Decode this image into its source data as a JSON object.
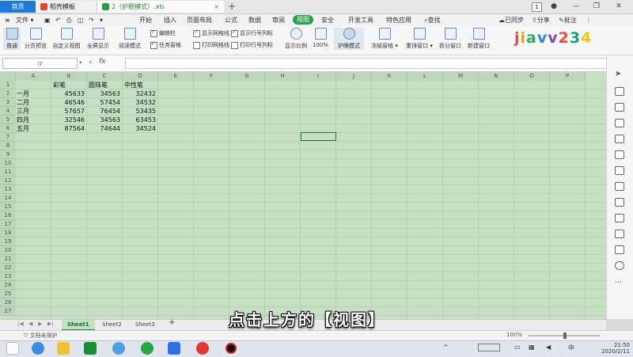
{
  "titlebar": {
    "tabs": [
      {
        "label": "首页"
      },
      {
        "label": "稻壳模板"
      },
      {
        "label": "2（护眼模式）.xls"
      }
    ],
    "add_tab": "+",
    "page_indicator": "1"
  },
  "menu": {
    "file_label": "文件",
    "items": [
      "开始",
      "插入",
      "页面布局",
      "公式",
      "数据",
      "审阅",
      "视图",
      "安全",
      "开发工具",
      "特色应用"
    ],
    "active": "视图",
    "search": "查找",
    "sync": "已同步",
    "share": "分享",
    "comment": "批注"
  },
  "ribbon": {
    "buttons": [
      "普通",
      "分页预览",
      "自定义视图",
      "全屏显示",
      "阅读模式",
      "显示比例",
      "100%",
      "护眼模式",
      "冻结窗格",
      "重排窗口",
      "拆分窗口",
      "新建窗口"
    ],
    "checks": [
      {
        "label": "编辑栏",
        "checked": true
      },
      {
        "label": "显示网格线",
        "checked": true
      },
      {
        "label": "显示行号列标",
        "checked": true
      },
      {
        "label": "任务窗格",
        "checked": true
      },
      {
        "label": "打印网格线",
        "checked": false
      },
      {
        "label": "打印行号列标",
        "checked": false
      }
    ],
    "watermark": "jiavv234"
  },
  "formula": {
    "namebox": "I7",
    "fx": "fx"
  },
  "sheet": {
    "columns": [
      "A",
      "B",
      "C",
      "D",
      "E",
      "F",
      "G",
      "H",
      "I",
      "J",
      "K",
      "L",
      "M",
      "N",
      "O",
      "P"
    ],
    "row_count": 27,
    "headers": [
      "彩笔",
      "圆珠笔",
      "中性笔"
    ],
    "rows": [
      {
        "month": "一月",
        "values": [
          45633,
          34563,
          32432
        ]
      },
      {
        "month": "二月",
        "values": [
          46546,
          57454,
          34532
        ]
      },
      {
        "month": "三月",
        "values": [
          57657,
          76454,
          53435
        ]
      },
      {
        "month": "四月",
        "values": [
          32546,
          34563,
          63453
        ]
      },
      {
        "month": "五月",
        "values": [
          87564,
          74644,
          34524
        ]
      }
    ],
    "tabs": [
      "Sheet1",
      "Sheet2",
      "Sheet3"
    ],
    "active_tab": "Sheet1"
  },
  "status": {
    "protection": "文档未保护",
    "zoom": "100%"
  },
  "subtitle": "点击上方的【视图】",
  "taskbar": {
    "time": "21:50",
    "date": "2020/2/11",
    "ime": "中"
  },
  "colors": {
    "grid_bg": "#c6e0c4",
    "accent": "#2aa04a",
    "home_tab": "#1c7bd6"
  }
}
